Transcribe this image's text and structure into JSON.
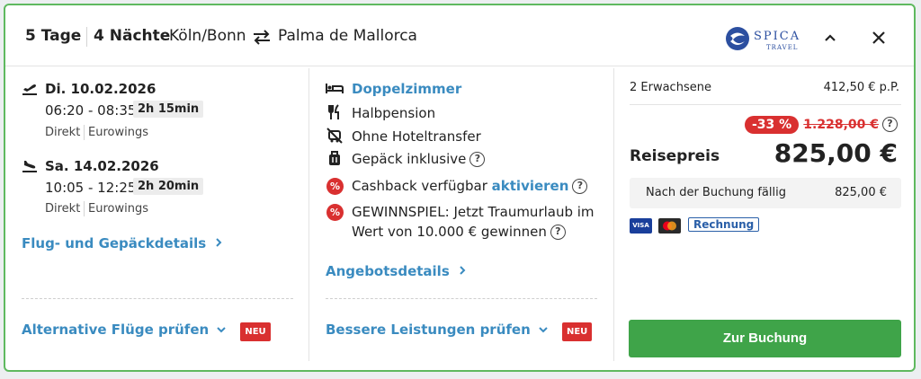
{
  "header": {
    "days": "5 Tage",
    "nights": "4 Nächte",
    "origin": "Köln/Bonn",
    "destination": "Palma de Mallorca",
    "logo_text": "SPICA",
    "logo_sub": "TRAVEL"
  },
  "outbound": {
    "date": "Di. 10.02.2026",
    "time": "06:20 - 08:35",
    "duration": "2h 15min",
    "type": "Direkt",
    "airline": "Eurowings"
  },
  "return": {
    "date": "Sa. 14.02.2026",
    "time": "10:05 - 12:25",
    "duration": "2h 20min",
    "type": "Direkt",
    "airline": "Eurowings"
  },
  "links": {
    "flight_details": "Flug- und Gepäckdetails",
    "alt_flights": "Alternative Flüge prüfen",
    "offer_details": "Angebotsdetails",
    "better_services": "Bessere Leistungen prüfen",
    "neu": "NEU"
  },
  "features": {
    "room": "Doppelzimmer",
    "board": "Halbpension",
    "transfer": "Ohne Hoteltransfer",
    "luggage": "Gepäck inklusive",
    "cashback": "Cashback verfügbar",
    "cashback_link": "aktivieren",
    "contest_line1": "GEWINNSPIEL: Jetzt Traumurlaub im",
    "contest_line2": "Wert von 10.000 € gewinnen",
    "pct": "%"
  },
  "pricing": {
    "travelers": "2 Erwachsene",
    "per_person": "412,50 € p.P.",
    "discount": "-33 %",
    "old_price": "1.228,00 €",
    "label": "Reisepreis",
    "price": "825,00 €",
    "due_label": "Nach der Buchung fällig",
    "due_amount": "825,00 €",
    "visa": "VISA",
    "rechnung": "Rechnung",
    "book": "Zur Buchung"
  },
  "colors": {
    "accent_link": "#3a8bc0",
    "book_button": "#3fa449",
    "discount": "#d93030",
    "card_border": "#5fb95f"
  }
}
